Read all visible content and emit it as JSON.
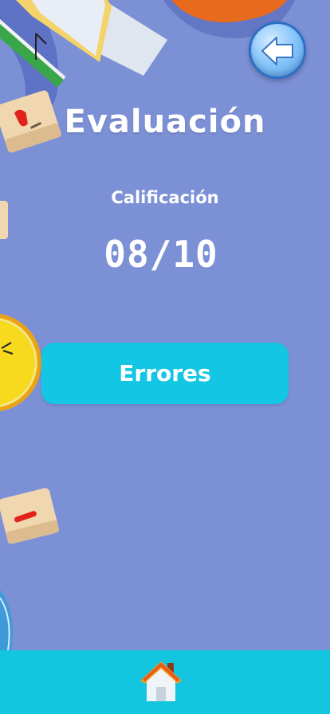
{
  "header": {
    "back_icon": "arrow-left-icon"
  },
  "main": {
    "title": "Evaluación",
    "grade_label": "Calificación",
    "grade_value": "08/10",
    "errors_button_label": "Errores"
  },
  "bottom_bar": {
    "home_icon": "home-icon"
  },
  "colors": {
    "background": "#7c90d6",
    "button": "#12c6e4",
    "bottom_bar": "#14c5e0",
    "text": "#ffffff"
  }
}
